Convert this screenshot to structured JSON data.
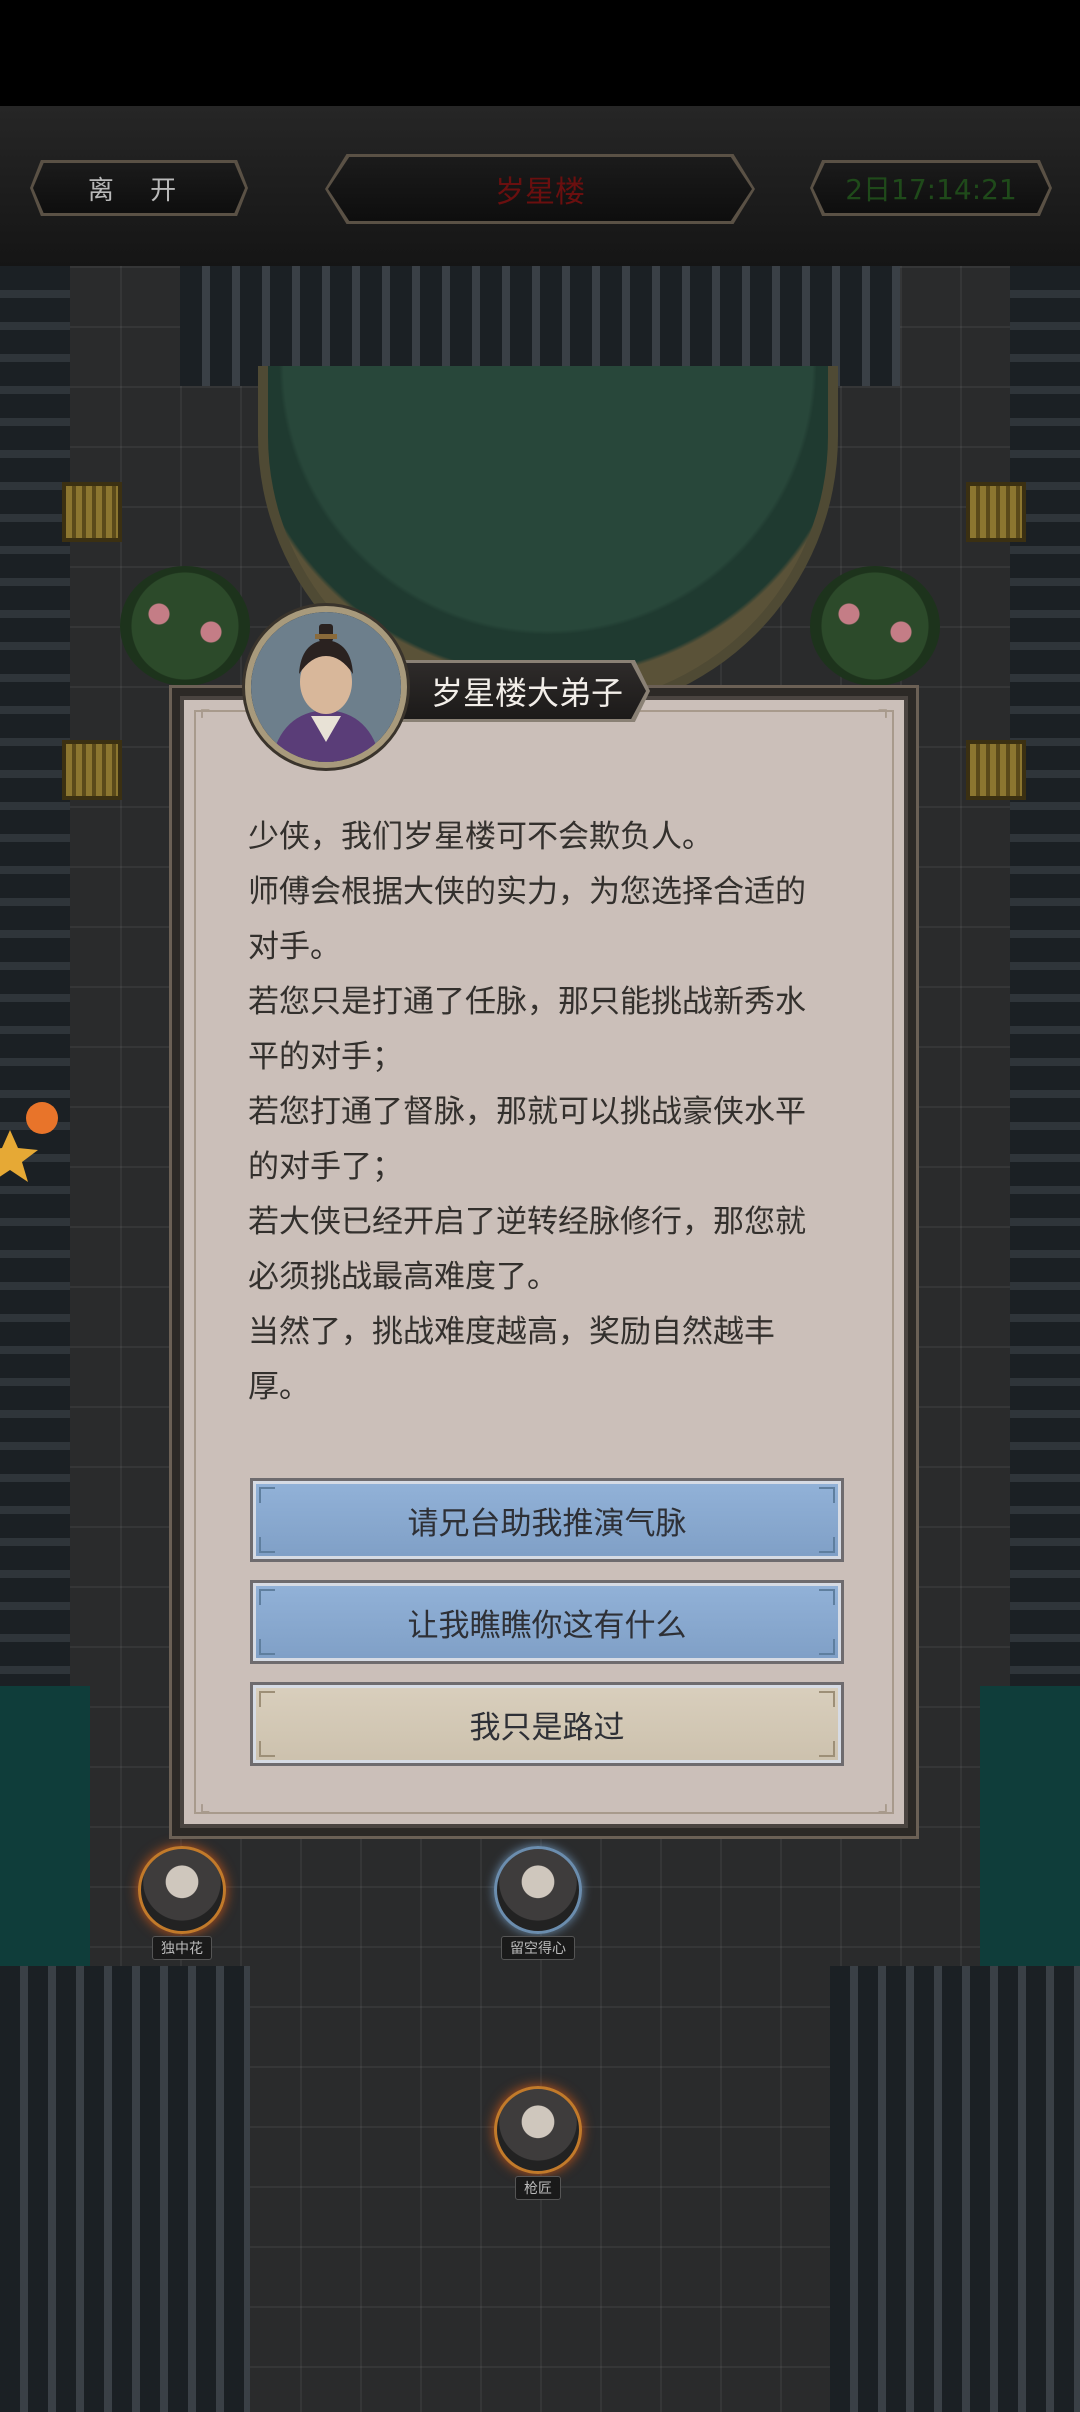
{
  "topbar": {
    "leave_label": "离 开",
    "location_title": "岁星楼",
    "timer": "2日17:14:21"
  },
  "dialog": {
    "speaker": "岁星楼大弟子",
    "paragraphs": [
      "少侠，我们岁星楼可不会欺负人。",
      "师傅会根据大侠的实力，为您选择合适的对手。",
      "若您只是打通了任脉，那只能挑战新秀水平的对手；",
      "若您打通了督脉，那就可以挑战豪侠水平的对手了；",
      "若大侠已经开启了逆转经脉修行，那您就必须挑战最高难度了。",
      "当然了，挑战难度越高，奖励自然越丰厚。"
    ],
    "choices": [
      {
        "label": "请兄台助我推演气脉",
        "style": "blue"
      },
      {
        "label": "让我瞧瞧你这有什么",
        "style": "blue"
      },
      {
        "label": "我只是路过",
        "style": "tan"
      }
    ]
  },
  "npcs": [
    {
      "name": "独中花"
    },
    {
      "name": "留空得心"
    },
    {
      "name": "枪匠"
    }
  ],
  "colors": {
    "title_red": "#6a0f0f",
    "timer_green": "#1f4a1a",
    "choice_blue": "#8aaad0",
    "choice_tan": "#d4c9b5",
    "dialog_bg": "#cbbfb9"
  }
}
